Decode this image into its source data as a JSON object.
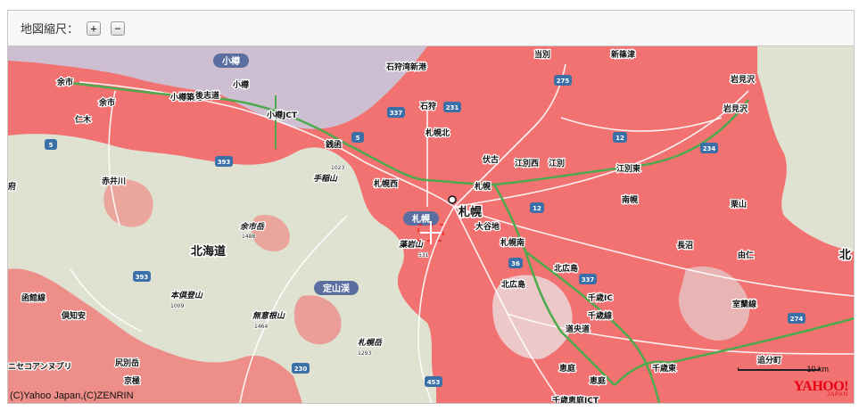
{
  "toolbar": {
    "zoom_label": "地図縮尺：",
    "zoom_in_label": "+",
    "zoom_out_label": "−"
  },
  "map": {
    "copyright": "(C)Yahoo Japan,(C)ZENRIN",
    "scale_text": "10 km",
    "brand": "YAHOO!",
    "brand_sub": "JAPAN",
    "colors": {
      "water": "#cdbfd1",
      "hazard": "#f27272",
      "land": "#dfe2d0",
      "rail": "#4caa4c",
      "road": "#ffffff",
      "route_badge": "#3a6fa8"
    },
    "city_labels": [
      {
        "id": "otaru",
        "text": "小樽"
      },
      {
        "id": "sapporo",
        "text": "札幌"
      },
      {
        "id": "jozankei",
        "text": "定山渓"
      }
    ],
    "large_labels": [
      {
        "id": "sapporo-city",
        "text": "札幌"
      },
      {
        "id": "hokkaido",
        "text": "北海道"
      }
    ],
    "places": [
      {
        "id": "yoichi",
        "text": "余市"
      },
      {
        "id": "yoichi-sta",
        "text": "余市"
      },
      {
        "id": "niki",
        "text": "仁木"
      },
      {
        "id": "otaru-chikko",
        "text": "小樽築港"
      },
      {
        "id": "gotenyama",
        "text": "後志道"
      },
      {
        "id": "otaru-jct",
        "text": "小樽JCT"
      },
      {
        "id": "otaru-sta",
        "text": "小樽"
      },
      {
        "id": "zenibako",
        "text": "銭函"
      },
      {
        "id": "ishikari-shinko",
        "text": "石狩湾新港"
      },
      {
        "id": "ishikari",
        "text": "石狩"
      },
      {
        "id": "sapporo-kita",
        "text": "札幌北"
      },
      {
        "id": "futo",
        "text": "伏古"
      },
      {
        "id": "ebetsu-nishi",
        "text": "江別西"
      },
      {
        "id": "ebetsu",
        "text": "江別"
      },
      {
        "id": "ebetsu-higashi",
        "text": "江別東"
      },
      {
        "id": "tobetsu",
        "text": "当別"
      },
      {
        "id": "shinshinotsu",
        "text": "新篠津"
      },
      {
        "id": "iwamizawa",
        "text": "岩見沢"
      },
      {
        "id": "iwamizawa-sta",
        "text": "岩見沢"
      },
      {
        "id": "sapporo-nishi",
        "text": "札幌西"
      },
      {
        "id": "sapporo-ic",
        "text": "札幌"
      },
      {
        "id": "oyachi",
        "text": "大谷地"
      },
      {
        "id": "nanporo",
        "text": "南幌"
      },
      {
        "id": "kuriyama",
        "text": "栗山"
      },
      {
        "id": "naganuma",
        "text": "長沼"
      },
      {
        "id": "sapporo-minami",
        "text": "札幌南"
      },
      {
        "id": "kitahiroshima",
        "text": "北広島"
      },
      {
        "id": "kitahiroshima-ic",
        "text": "北広島"
      },
      {
        "id": "yuni",
        "text": "由仁"
      },
      {
        "id": "akaigawa",
        "text": "赤井川"
      },
      {
        "id": "chitose-ic",
        "text": "千歳IC"
      },
      {
        "id": "eniwa",
        "text": "恵庭"
      },
      {
        "id": "eniwa-sta",
        "text": "恵庭"
      },
      {
        "id": "chitose-higashi",
        "text": "千歳東"
      },
      {
        "id": "oiwake",
        "text": "追分町"
      },
      {
        "id": "kutchan",
        "text": "倶知安"
      },
      {
        "id": "niseko",
        "text": "ニセコアンヌプリ"
      },
      {
        "id": "shiribeshi",
        "text": "尻別岳"
      },
      {
        "id": "kyogoku",
        "text": "京極"
      },
      {
        "id": "shin-chitose-jct",
        "text": "千歳恵庭JCT"
      },
      {
        "id": "tomamu-line",
        "text": "室蘭線"
      },
      {
        "id": "chitose-line",
        "text": "千歳線"
      },
      {
        "id": "doo-line",
        "text": "道央道"
      },
      {
        "id": "hakodate-line",
        "text": "函館線"
      },
      {
        "id": "kita-edge",
        "text": "北"
      },
      {
        "id": "fu-edge",
        "text": "府"
      }
    ],
    "mountains": [
      {
        "id": "teine",
        "text": "手稲山",
        "elev": "1023"
      },
      {
        "id": "yoichidake",
        "text": "余市岳",
        "elev": "1488"
      },
      {
        "id": "moiwa",
        "text": "藻岩山",
        "elev": "531"
      },
      {
        "id": "shiribetsu-dake",
        "text": "本倶登山",
        "elev": "1009"
      },
      {
        "id": "muizan",
        "text": "無意根山",
        "elev": "1464"
      },
      {
        "id": "sapporodake",
        "text": "札幌岳",
        "elev": "1293"
      }
    ],
    "routes": [
      {
        "id": "r5a",
        "text": "5"
      },
      {
        "id": "r5b",
        "text": "5"
      },
      {
        "id": "r231",
        "text": "231"
      },
      {
        "id": "r337a",
        "text": "337"
      },
      {
        "id": "r337b",
        "text": "337"
      },
      {
        "id": "r275",
        "text": "275"
      },
      {
        "id": "r12a",
        "text": "12"
      },
      {
        "id": "r12b",
        "text": "12"
      },
      {
        "id": "r234",
        "text": "234"
      },
      {
        "id": "r393a",
        "text": "393"
      },
      {
        "id": "r393b",
        "text": "393"
      },
      {
        "id": "r36",
        "text": "36"
      },
      {
        "id": "r230",
        "text": "230"
      },
      {
        "id": "r453",
        "text": "453"
      },
      {
        "id": "r274",
        "text": "274"
      }
    ]
  }
}
